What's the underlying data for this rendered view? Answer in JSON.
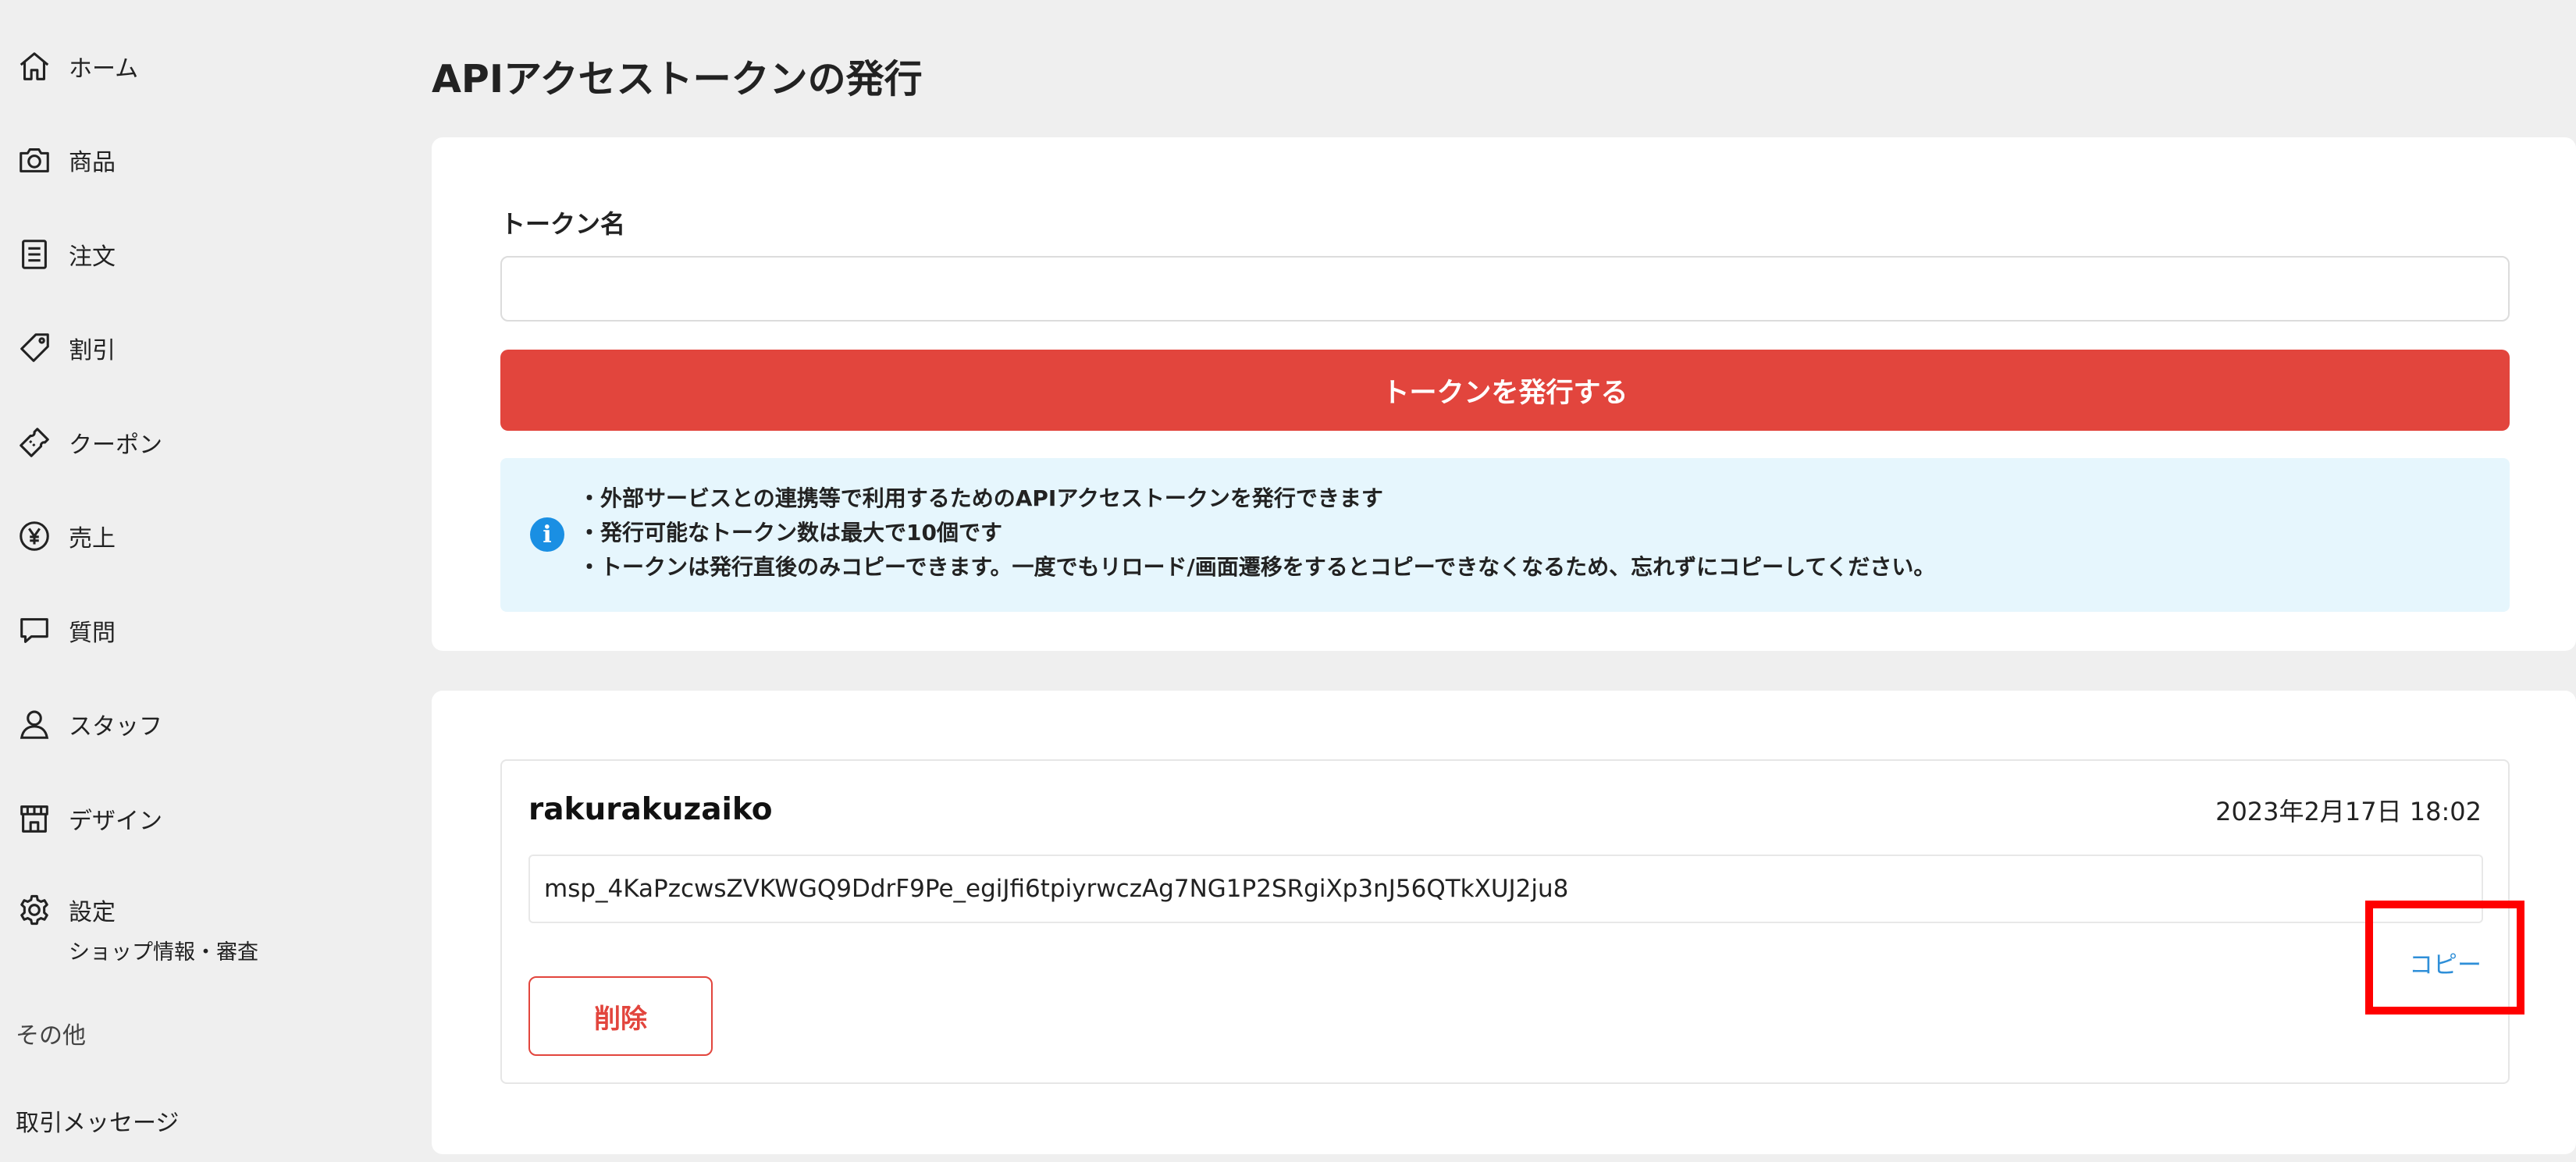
{
  "sidebar": {
    "items": [
      {
        "label": "ホーム",
        "icon": "home-icon"
      },
      {
        "label": "商品",
        "icon": "camera-icon"
      },
      {
        "label": "注文",
        "icon": "order-list-icon"
      },
      {
        "label": "割引",
        "icon": "tag-icon"
      },
      {
        "label": "クーポン",
        "icon": "ticket-icon"
      },
      {
        "label": "売上",
        "icon": "yen-icon"
      },
      {
        "label": "質問",
        "icon": "chat-icon"
      },
      {
        "label": "スタッフ",
        "icon": "person-icon"
      },
      {
        "label": "デザイン",
        "icon": "storefront-icon"
      },
      {
        "label": "設定",
        "icon": "gear-icon",
        "sublabel": "ショップ情報・審査"
      }
    ],
    "other_heading": "その他",
    "messages_label": "取引メッセージ"
  },
  "page": {
    "title": "APIアクセストークンの発行"
  },
  "form": {
    "name_label": "トークン名",
    "name_value": "",
    "name_placeholder": "",
    "issue_button": "トークンを発行する",
    "info_lines": [
      "・外部サービスとの連携等で利用するためのAPIアクセストークンを発行できます",
      "・発行可能なトークン数は最大で10個です",
      "・トークンは発行直後のみコピーできます。一度でもリロード/画面遷移をするとコピーできなくなるため、忘れずにコピーしてください。"
    ],
    "info_icon_glyph": "i"
  },
  "token": {
    "name": "rakurakuzaiko",
    "created_at": "2023年2月17日 18:02",
    "value": "msp_4KaPzcwsZVKWGQ9DdrF9Pe_egiJfi6tpiyrwczAg7NG1P2SRgiXp3nJ56QTkXUJ2ju8",
    "copy_label": "コピー",
    "delete_label": "削除"
  },
  "colors": {
    "primary_red": "#e2453d",
    "link_blue": "#2f8fd8",
    "info_bg": "#e6f6fd",
    "highlight": "#ff0000"
  }
}
